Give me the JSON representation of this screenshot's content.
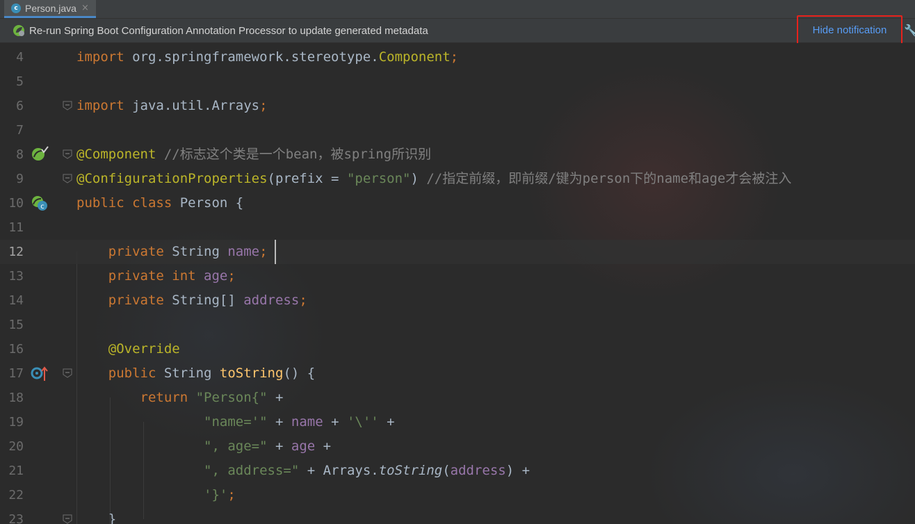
{
  "tab": {
    "label": "Person.java",
    "icon": "class-icon",
    "icon_letter": "c",
    "close": "×"
  },
  "notification": {
    "text": "Re-run Spring Boot Configuration Annotation Processor to update generated metadata",
    "hide_label": "Hide notification"
  },
  "editor": {
    "current_line": "12",
    "lines": [
      {
        "n": "4",
        "tokens": [
          [
            "kw",
            "import "
          ],
          [
            "",
            "org.springframework.stereotype."
          ],
          [
            "an",
            "Component"
          ],
          [
            "kw",
            ";"
          ]
        ]
      },
      {
        "n": "5",
        "tokens": []
      },
      {
        "n": "6",
        "tokens": [
          [
            "kw",
            "import "
          ],
          [
            "",
            "java.util.Arrays"
          ],
          [
            "kw",
            ";"
          ]
        ]
      },
      {
        "n": "7",
        "tokens": []
      },
      {
        "n": "8",
        "tokens": [
          [
            "an",
            "@Component "
          ],
          [
            "cm",
            "//标志这个类是一个bean，被spring所识别"
          ]
        ]
      },
      {
        "n": "9",
        "tokens": [
          [
            "an",
            "@ConfigurationProperties"
          ],
          [
            "",
            "(prefix = "
          ],
          [
            "st",
            "\"person\""
          ],
          [
            "",
            ") "
          ],
          [
            "cm",
            "//指定前缀，即前缀/键为person下的name和age才会被注入"
          ]
        ]
      },
      {
        "n": "10",
        "tokens": [
          [
            "kw",
            "public class "
          ],
          [
            "",
            "Person {"
          ]
        ]
      },
      {
        "n": "11",
        "tokens": []
      },
      {
        "n": "12",
        "tokens": [
          [
            "",
            "    "
          ],
          [
            "kw",
            "private "
          ],
          [
            "",
            "String "
          ],
          [
            "fd",
            "name"
          ],
          [
            "kw",
            ";"
          ]
        ]
      },
      {
        "n": "13",
        "tokens": [
          [
            "",
            "    "
          ],
          [
            "kw",
            "private int "
          ],
          [
            "fd",
            "age"
          ],
          [
            "kw",
            ";"
          ]
        ]
      },
      {
        "n": "14",
        "tokens": [
          [
            "",
            "    "
          ],
          [
            "kw",
            "private "
          ],
          [
            "",
            "String[] "
          ],
          [
            "fd",
            "address"
          ],
          [
            "kw",
            ";"
          ]
        ]
      },
      {
        "n": "15",
        "tokens": []
      },
      {
        "n": "16",
        "tokens": [
          [
            "",
            "    "
          ],
          [
            "an",
            "@Override"
          ]
        ]
      },
      {
        "n": "17",
        "tokens": [
          [
            "",
            "    "
          ],
          [
            "kw",
            "public "
          ],
          [
            "",
            "String "
          ],
          [
            "fn",
            "toString"
          ],
          [
            "",
            "() {"
          ]
        ]
      },
      {
        "n": "18",
        "tokens": [
          [
            "",
            "        "
          ],
          [
            "kw",
            "return "
          ],
          [
            "st",
            "\"Person{\""
          ],
          [
            "",
            " +"
          ]
        ]
      },
      {
        "n": "19",
        "tokens": [
          [
            "",
            "                "
          ],
          [
            "st",
            "\"name='\""
          ],
          [
            "",
            " + "
          ],
          [
            "fd",
            "name"
          ],
          [
            "",
            " + "
          ],
          [
            "st",
            "'\\''"
          ],
          [
            "",
            " +"
          ]
        ]
      },
      {
        "n": "20",
        "tokens": [
          [
            "",
            "                "
          ],
          [
            "st",
            "\", age=\""
          ],
          [
            "",
            " + "
          ],
          [
            "fd",
            "age"
          ],
          [
            "",
            " +"
          ]
        ]
      },
      {
        "n": "21",
        "tokens": [
          [
            "",
            "                "
          ],
          [
            "st",
            "\", address=\""
          ],
          [
            "",
            " + Arrays."
          ],
          [
            "it",
            "toString"
          ],
          [
            "",
            "("
          ],
          [
            "fd",
            "address"
          ],
          [
            "",
            ") +"
          ]
        ]
      },
      {
        "n": "22",
        "tokens": [
          [
            "",
            "                "
          ],
          [
            "st",
            "'}'"
          ],
          [
            "kw",
            ";"
          ]
        ]
      },
      {
        "n": "23",
        "tokens": [
          [
            "",
            "    }"
          ]
        ]
      }
    ]
  },
  "gutter_icons": [
    {
      "line": "8",
      "name": "bean-check-icon"
    },
    {
      "line": "10",
      "name": "bean-class-icon"
    },
    {
      "line": "17",
      "name": "override-up-icon"
    }
  ],
  "colors": {
    "keyword": "#cc7832",
    "annotation": "#bbb529",
    "string": "#6a8759",
    "comment": "#808080",
    "field": "#9876aa",
    "method": "#ffc66d",
    "highlight": "#e8221c",
    "link": "#589df6"
  }
}
